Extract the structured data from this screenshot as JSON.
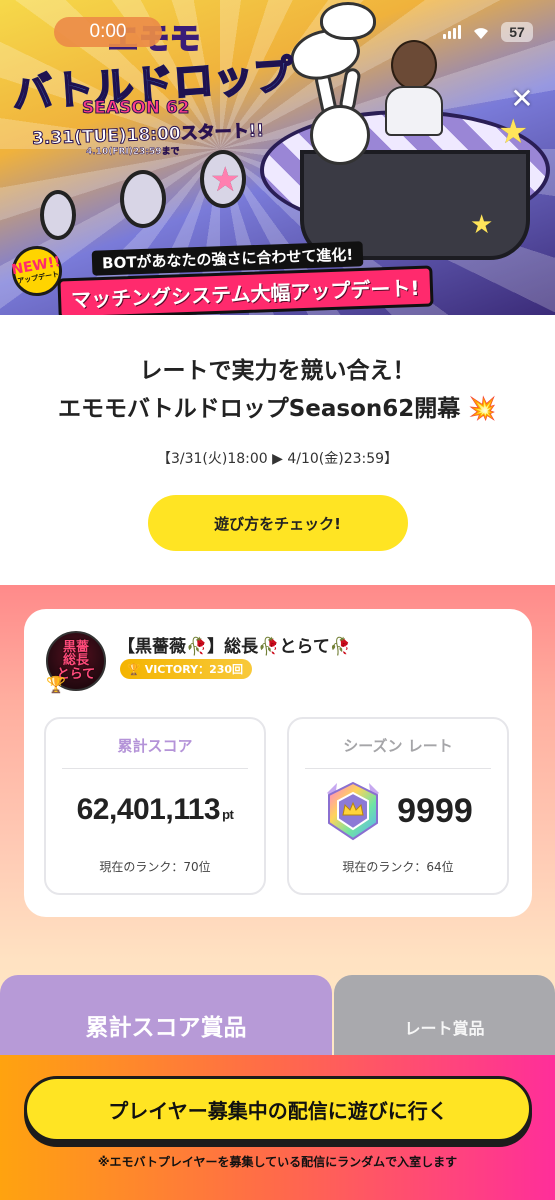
{
  "status_bar": {
    "timer": "0:00",
    "battery": "57"
  },
  "banner": {
    "logo_top": "エモモ",
    "logo_main": "バトルドロップ",
    "season_label": "SEASON 62",
    "start_text": "3.31(TUE)18:00スタート!!",
    "end_text": "4.10(FRI)23:59まで",
    "new_badge": "NEW!!",
    "new_badge_sub": "アップデート",
    "headline_small": "BOTがあなたの強さに合わせて進化!",
    "headline_big": "マッチングシステム大幅アップデート!"
  },
  "intro": {
    "title_line1": "レートで実力を競い合え！",
    "title_line2": "エモモバトルドロップSeason62開幕 💥",
    "period": "【3/31(火)18:00 ▶ 4/10(金)23:59】",
    "check_button": "遊び方をチェック!"
  },
  "profile": {
    "avatar_text": "黒薔\n総長\nとらて",
    "username": "【黒薔薇🥀】総長🥀とらて🥀",
    "victory_label": "VICTORY：230回"
  },
  "stats": {
    "score": {
      "label": "累計スコア",
      "value": "62,401,113",
      "unit": "pt",
      "rank": "現在のランク：70位"
    },
    "rate": {
      "label": "シーズン レート",
      "value": "9999",
      "rank": "現在のランク：64位"
    }
  },
  "tabs": {
    "score_tab": "累計スコア賞品",
    "rate_tab": "レート賞品"
  },
  "cta": {
    "button": "プレイヤー募集中の配信に遊びに行く",
    "note": "※エモバトプレイヤーを募集している配信にランダムで入室します"
  },
  "colors": {
    "accent_yellow": "#ffe423",
    "score_purple": "#b79ad7",
    "rate_gray": "#a9a9ad",
    "victory_gold": "#f4b400",
    "cta_gradient_start": "#ffa30f",
    "cta_gradient_end": "#ff2e9a"
  }
}
